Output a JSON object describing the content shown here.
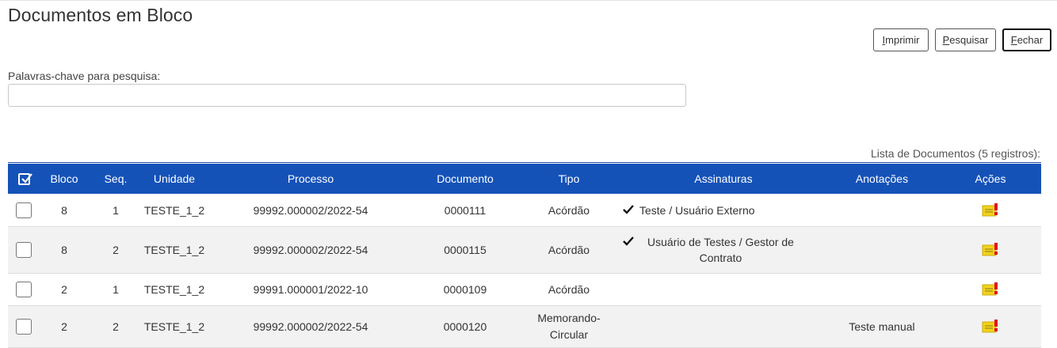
{
  "page": {
    "title": "Documentos em Bloco"
  },
  "toolbar": {
    "print": {
      "accesskey": "I",
      "rest": "mprimir"
    },
    "search": {
      "accesskey": "P",
      "rest": "esquisar"
    },
    "close": {
      "accesskey": "F",
      "rest": "echar"
    }
  },
  "search": {
    "label": "Palavras-chave para pesquisa:",
    "value": ""
  },
  "list": {
    "caption": "Lista de Documentos (5 registros):"
  },
  "table": {
    "headers": {
      "bloco": "Bloco",
      "seq": "Seq.",
      "unidade": "Unidade",
      "processo": "Processo",
      "documento": "Documento",
      "tipo": "Tipo",
      "assinaturas": "Assinaturas",
      "anotacoes": "Anotações",
      "acoes": "Ações"
    },
    "rows": [
      {
        "bloco": "8",
        "seq": "1",
        "unidade": "TESTE_1_2",
        "processo": "99992.000002/2022-54",
        "documento": "0000111",
        "tipo": "Acórdão",
        "assinaturas": "Teste / Usuário Externo",
        "anotacoes": ""
      },
      {
        "bloco": "8",
        "seq": "2",
        "unidade": "TESTE_1_2",
        "processo": "99992.000002/2022-54",
        "documento": "0000115",
        "tipo": "Acórdão",
        "assinaturas": "Usuário de Testes / Gestor de Contrato",
        "anotacoes": ""
      },
      {
        "bloco": "2",
        "seq": "1",
        "unidade": "TESTE_1_2",
        "processo": "99991.000001/2022-10",
        "documento": "0000109",
        "tipo": "Acórdão",
        "assinaturas": "",
        "anotacoes": ""
      },
      {
        "bloco": "2",
        "seq": "2",
        "unidade": "TESTE_1_2",
        "processo": "99992.000002/2022-54",
        "documento": "0000120",
        "tipo": "Memorando-Circular",
        "assinaturas": "",
        "anotacoes": "Teste manual"
      }
    ]
  },
  "icons": {
    "select_all": "checkbox-checked-icon",
    "signed": "checkmark-icon",
    "annotation": "annotation-note-icon"
  },
  "colors": {
    "header_bg": "#1552b8",
    "bloco_text": "#d9382b",
    "link_text": "#2c8a2c",
    "note_icon": "#f2d21a",
    "note_flag": "#e0141e"
  }
}
